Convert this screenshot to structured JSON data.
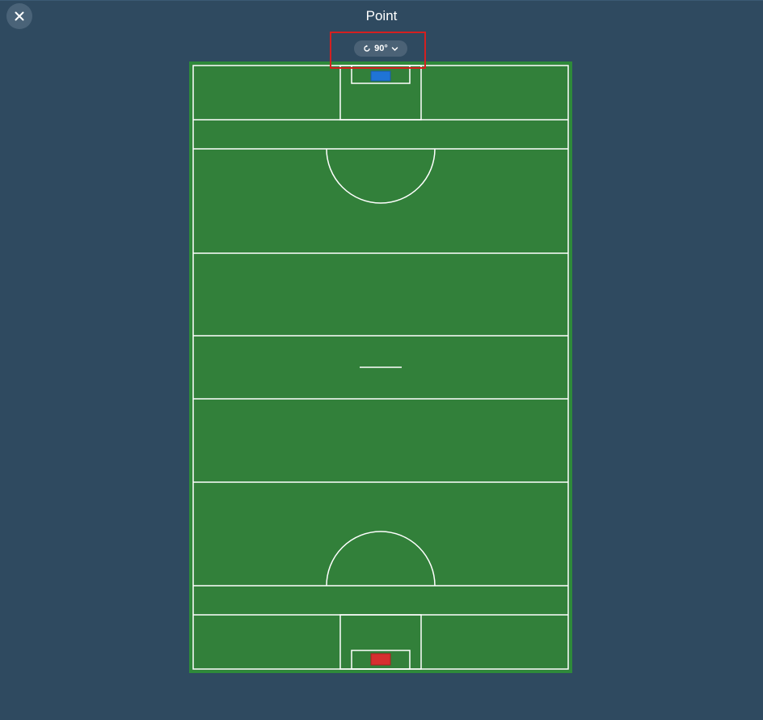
{
  "header": {
    "title": "Point",
    "close_icon": "close-icon"
  },
  "rotation": {
    "value": "90°",
    "rotate_icon": "rotate-icon",
    "dropdown_icon": "chevron-down-icon"
  },
  "pitch": {
    "grass_color": "#32803a",
    "line_color": "#ffffff",
    "border_color": "#2e8a3a",
    "top_goal_color": "#1f74d6",
    "bottom_goal_color": "#d62f2f"
  }
}
